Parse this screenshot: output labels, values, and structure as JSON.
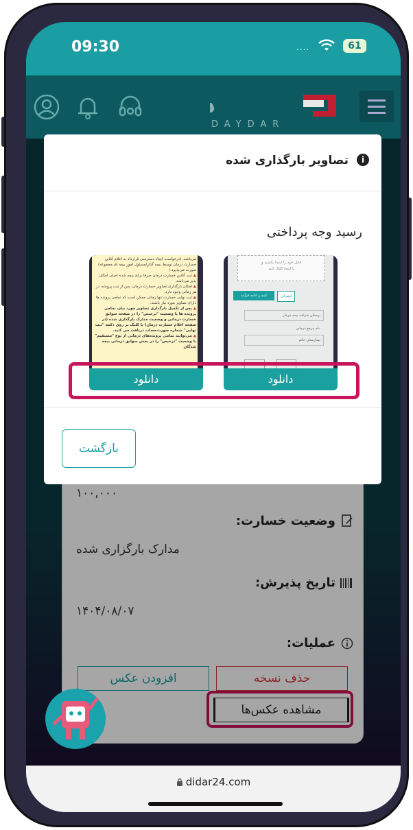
{
  "status_bar": {
    "time": "09:30",
    "signal_dots": "....",
    "battery": "61"
  },
  "header": {
    "logo_word": "DAYDAR",
    "logo_mark": "دی‌دار"
  },
  "modal": {
    "title": "تصاویر بارگذاری شده",
    "section_title": "رسید وجه پرداختی",
    "download_left": "دانلود",
    "download_right": "دانلود",
    "back_label": "بازگشت"
  },
  "thumb_right": {
    "upload_text1": "فایل خود را اینجا بکشید و",
    "upload_text2": "یا اینجا کلیک کنید",
    "cancel": "انصراف",
    "confirm": "تایید و ادامه فرآیند",
    "field1": "پرستان شرکت بیمه دی‌دار",
    "field2": "نام مرجع درمانی",
    "field3": "بیمارستان خاتم"
  },
  "thumb_left": {
    "lines": [
      "می‌باشد. (درخواست ایجاد دسترسی قرارداد به اعلام آنلاین خسارت درمان توسط بیمه گذار/مسئول امور بیمه ای مجموعه) صورت می‌پذیرد.)",
      "ثبت آنلاین خسارت درمان صرفا برای بیمه شده اصلی امکان پذیر می‌باشد.",
      "امکان بارگذاری تصاویر خسارت درمان، پس از ثبت پرونده، در هر زمانی وجود دارد.",
      "ثبت نهایی خسارت تنها زمانی ممکن است که تمامی پرونده ها دارای تصاویر مورد نیاز باشند.",
      "پس از تکمیل بارگذاری تصاویر مورد نیاز، تمامی پرونده ها با وضعیت \"ترخیص\" را در صفحه سوابق خسارت درمانی و وضعیت مدارک بارگذاری شده (در صفحه اعلام خسارت درمان) با کلیک بر روی دکمه \"ثبت نهایی\" شماره صورت‌حساب دریافت می کنید.",
      "می‌توانید تمامی پرونده‌های درمانی از نوع \"مستقیم\" با وضعیت \"ترخیص\" را در بخش سوابق درمانی بیمه شدگان"
    ]
  },
  "card": {
    "amount": "۱۰۰,۰۰۰",
    "status_label": "وضعیت خسارت:",
    "status_value": "مدارک بارگزاری شده",
    "date_label": "تاریخ پذیرش:",
    "date_value": "۱۴۰۴/۰۸/۰۷",
    "ops_label": "عملیات:",
    "delete_btn": "حذف نسخه",
    "add_photo_btn": "افزودن عکس",
    "view_photos_btn": "مشاهده عکس‌ها"
  },
  "browser": {
    "url": "didar24.com"
  },
  "colors": {
    "teal": "#1aa09e",
    "highlight": "#c8145a",
    "danger": "#d63a3a"
  }
}
